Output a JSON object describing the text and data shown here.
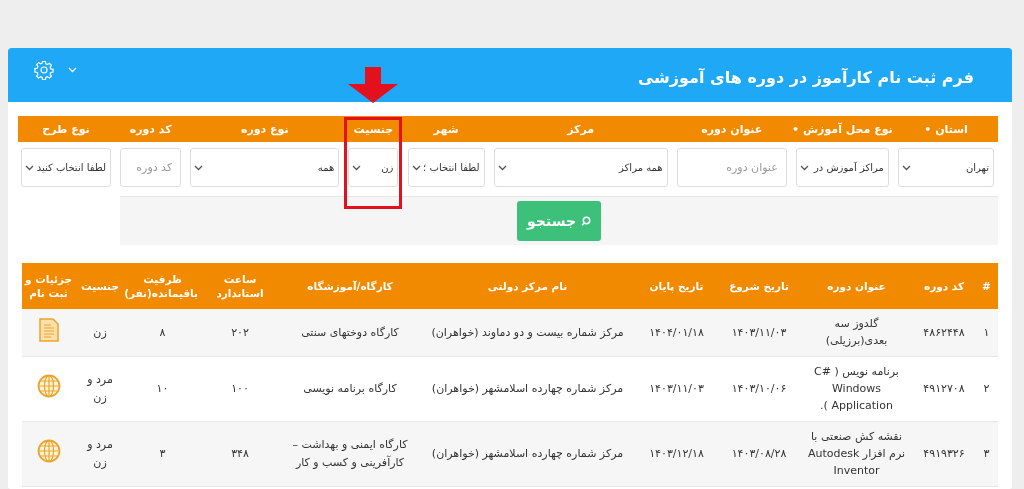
{
  "header": {
    "title": "فرم ثبت نام کارآموز در دوره های آموزشی"
  },
  "filters": [
    {
      "label": "استان •",
      "kind": "select",
      "value": "تهران",
      "highlighted": false
    },
    {
      "label": "نوع محل آموزش •",
      "kind": "select",
      "value": "مراکز آموزش در",
      "highlighted": false
    },
    {
      "label": "عنوان دوره",
      "kind": "input",
      "placeholder": "عنوان دوره",
      "highlighted": false
    },
    {
      "label": "مرکز",
      "kind": "select",
      "value": "همه مراکز",
      "highlighted": false
    },
    {
      "label": "شهر",
      "kind": "select",
      "value": "لطفا انتخاب ؛",
      "highlighted": false
    },
    {
      "label": "جنسیت",
      "kind": "select",
      "value": "زن",
      "highlighted": true
    },
    {
      "label": "نوع دوره",
      "kind": "select",
      "value": "همه",
      "highlighted": false
    },
    {
      "label": "کد دوره",
      "kind": "input",
      "placeholder": "کد دوره",
      "highlighted": false
    },
    {
      "label": "نوع طرح",
      "kind": "select",
      "value": "لطفا انتخاب کنید",
      "highlighted": false
    }
  ],
  "search_button": "جستجو",
  "table": {
    "columns": [
      "#",
      "کد دوره",
      "عنوان دوره",
      "تاریخ شروع",
      "تاریخ پایان",
      "نام مرکز دولتی",
      "کارگاه/آموزشگاه",
      "ساعت استاندارد",
      "ظرفیت باقیمانده(نفر)",
      "جنسیت",
      "جزئیات و ثبت نام"
    ],
    "rows": [
      {
        "cells": [
          "۱",
          "۴۸۶۲۴۴۸",
          "گلدوز سه بعدی(برزیلی)",
          "۱۴۰۳/۱۱/۰۳",
          "۱۴۰۴/۰۱/۱۸",
          "مرکز شماره بیست و دو دماوند (خواهران)",
          "کارگاه دوختهای سنتی",
          "۲۰۲",
          "۸",
          "زن"
        ],
        "kind": "document"
      },
      {
        "cells": [
          "۲",
          "۴۹۱۲۷۰۸",
          "برنامه نویس ( C# Windows Application ).",
          "۱۴۰۳/۱۰/۰۶",
          "۱۴۰۳/۱۱/۰۳",
          "مرکز شماره چهارده اسلامشهر (خواهران)",
          "کارگاه برنامه نویسی",
          "۱۰۰",
          "۱۰",
          "مرد و زن"
        ],
        "kind": "globe"
      },
      {
        "cells": [
          "۳",
          "۴۹۱۹۳۲۶",
          "نقشه کش صنعتی با نرم افزار Autodesk Inventor",
          "۱۴۰۳/۰۸/۲۸",
          "۱۴۰۳/۱۲/۱۸",
          "مرکز شماره چهارده اسلامشهر (خواهران)",
          "کارگاه ایمنی و بهداشت – کارآفرینی و کسب و کار",
          "۳۴۸",
          "۳",
          "مرد و زن"
        ],
        "kind": "globe"
      }
    ]
  }
}
